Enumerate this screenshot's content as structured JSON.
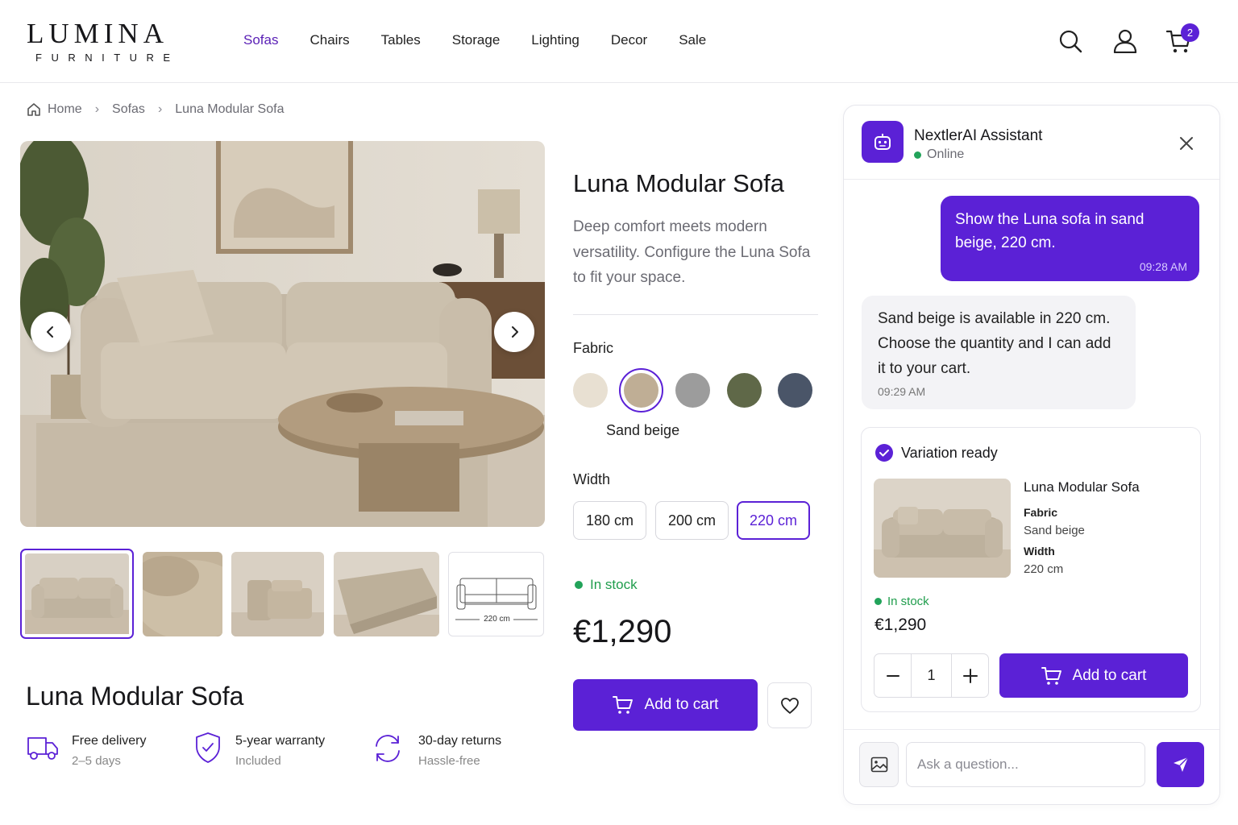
{
  "brand": {
    "name": "LUMINA",
    "tagline": "FURNITURE"
  },
  "nav": {
    "items": [
      "Sofas",
      "Chairs",
      "Tables",
      "Storage",
      "Lighting",
      "Decor",
      "Sale"
    ],
    "active": "Sofas"
  },
  "header": {
    "cart_count": "2",
    "icons": [
      "search-icon",
      "user-icon",
      "cart-icon"
    ]
  },
  "breadcrumb": [
    "Home",
    "Sofas",
    "Luna Modular Sofa"
  ],
  "gallery": {
    "thumbnails": [
      "sofa-front",
      "fabric-closeup",
      "sofa-modular-angle",
      "sofa-back",
      "dimension-drawing"
    ],
    "selected_index": 0,
    "dimension_label": "220 cm"
  },
  "product": {
    "title": "Luna Modular Sofa",
    "description": "Deep comfort meets modern versatility. Configure the Luna Sofa to fit your space.",
    "fabric_label": "Fabric",
    "fabrics": [
      {
        "name": "Cream",
        "color": "#e8e0d2"
      },
      {
        "name": "Sand beige",
        "color": "#bfae95"
      },
      {
        "name": "Grey",
        "color": "#9c9c9c"
      },
      {
        "name": "Olive",
        "color": "#5f6848"
      },
      {
        "name": "Slate blue",
        "color": "#4a5568"
      }
    ],
    "selected_fabric": "Sand beige",
    "width_label": "Width",
    "widths": [
      "180 cm",
      "200 cm",
      "220 cm"
    ],
    "selected_width": "220 cm",
    "stock": "In stock",
    "price": "€1,290",
    "add_to_cart": "Add to cart"
  },
  "footer_title": "Luna Modular Sofa",
  "features": [
    {
      "title": "Free delivery",
      "sub": "2–5 days",
      "icon": "truck-icon"
    },
    {
      "title": "5-year warranty",
      "sub": "Included",
      "icon": "shield-icon"
    },
    {
      "title": "30-day returns",
      "sub": "Hassle-free",
      "icon": "returns-icon"
    }
  ],
  "chat": {
    "assistant_name": "NextlerAI Assistant",
    "status": "Online",
    "messages": [
      {
        "from": "user",
        "text": "Show the Luna sofa in sand beige, 220 cm.",
        "time": "09:28 AM"
      },
      {
        "from": "bot",
        "text": "Sand beige is available in 220 cm. Choose the quantity and I can add it to your cart.",
        "time": "09:29 AM"
      }
    ],
    "variation": {
      "heading": "Variation ready",
      "name": "Luna Modular Sofa",
      "fabric_key": "Fabric",
      "fabric_value": "Sand beige",
      "width_key": "Width",
      "width_value": "220 cm",
      "stock": "In stock",
      "price": "€1,290",
      "quantity": "1",
      "add_to_cart": "Add to cart"
    },
    "input_placeholder": "Ask a question..."
  },
  "colors": {
    "accent": "#5b21d6",
    "stock_green": "#22a35a"
  }
}
